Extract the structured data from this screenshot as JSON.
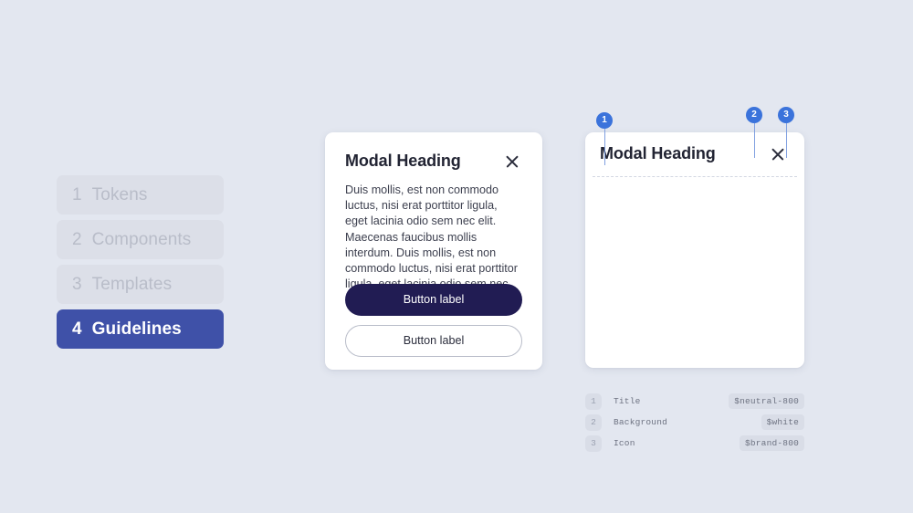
{
  "background_color": "#e3e7f0",
  "nav": {
    "items": [
      {
        "num": "1",
        "label": "Tokens",
        "active": false
      },
      {
        "num": "2",
        "label": "Components",
        "active": false
      },
      {
        "num": "3",
        "label": "Templates",
        "active": false
      },
      {
        "num": "4",
        "label": "Guidelines",
        "active": true
      }
    ],
    "active_color": "#3f51a8",
    "inactive_color": "#dcdfe8"
  },
  "modal_filled": {
    "title": "Modal Heading",
    "close_icon": "close-icon",
    "body": "Duis mollis, est non commodo luctus, nisi erat porttitor ligula, eget lacinia odio sem nec elit. Maecenas faucibus mollis interdum. Duis mollis, est non commodo luctus, nisi erat porttitor ligula, eget lacinia odio sem nec elit.",
    "primary_button": "Button label",
    "secondary_button": "Button label",
    "primary_color": "#211c53"
  },
  "modal_spec": {
    "title": "Modal Heading",
    "close_icon": "close-icon"
  },
  "callouts": [
    {
      "id": "1",
      "color": "#3b73db"
    },
    {
      "id": "2",
      "color": "#3b73db"
    },
    {
      "id": "3",
      "color": "#3b73db"
    }
  ],
  "legend": {
    "rows": [
      {
        "num": "1",
        "label": "Title",
        "token": "$neutral-800"
      },
      {
        "num": "2",
        "label": "Background",
        "token": "$white"
      },
      {
        "num": "3",
        "label": "Icon",
        "token": "$brand-800"
      }
    ]
  }
}
